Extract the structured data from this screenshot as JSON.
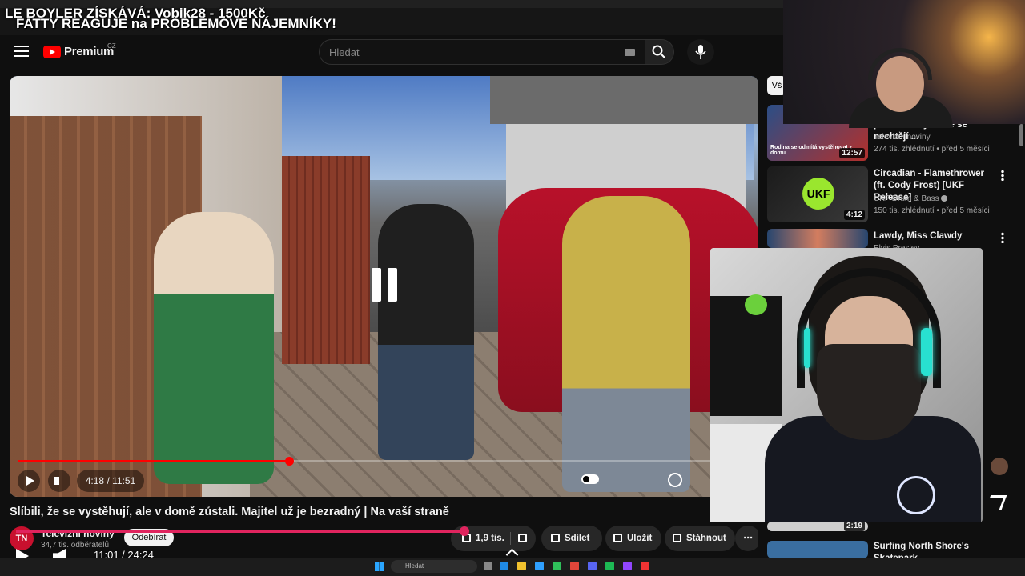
{
  "overlay": {
    "line1": "LE BOYLER ZÍSKÁVÁ: Vobik28 - 1500Kč",
    "line2": "FATTY REAGUJE na PROBLÉMOVÉ NÁJEMNÍKY!"
  },
  "header": {
    "logo_text": "Premium",
    "country": "CZ",
    "search_placeholder": "Hledat"
  },
  "player": {
    "time": "4:18 / 11:51",
    "bottom_time": "11:01 / 24:24"
  },
  "video": {
    "title": "Slíbili, že se vystěhují, ale v domě zůstali. Majitel už je bezradný | Na vaší straně",
    "channel": "Televizní noviny",
    "avatar_text": "TN",
    "subscribers": "34,7 tis. odběratelů",
    "subscribe_label": "Odebírat",
    "likes": "1,9 tis.",
    "share_label": "Sdílet",
    "save_label": "Uložit",
    "download_label": "Stáhnout"
  },
  "sidebar": {
    "chip": "Vš",
    "items": [
      {
        "title": "původní obyvatelé se nechtějí ...",
        "channel": "Televizní noviny",
        "meta": "274 tis. zhlédnutí • před 5 měsíci",
        "duration": "12:57",
        "thumb_text": "Rodina se odmítá vystěhovat z domu"
      },
      {
        "title": "Circadian - Flamethrower (ft. Cody Frost) [UKF Release]",
        "channel": "UKF Drum & Bass",
        "meta": "150 tis. zhlédnutí • před 5 měsíci",
        "duration": "4:12",
        "thumb_text": "UKF"
      },
      {
        "title": "Lawdy, Miss Clawdy",
        "channel": "Elvis Presley",
        "meta": "",
        "duration": "",
        "thumb_text": ""
      },
      {
        "title": "Surfing North Shore's Skatepark",
        "channel": "",
        "meta": "",
        "duration": "2:19",
        "thumb_text": ""
      }
    ]
  },
  "taskbar": {
    "search_placeholder": "Hledat"
  },
  "colors": {
    "accent": "#ff0000",
    "progress": "#e0245e",
    "channel_avatar": "#c8102e"
  }
}
